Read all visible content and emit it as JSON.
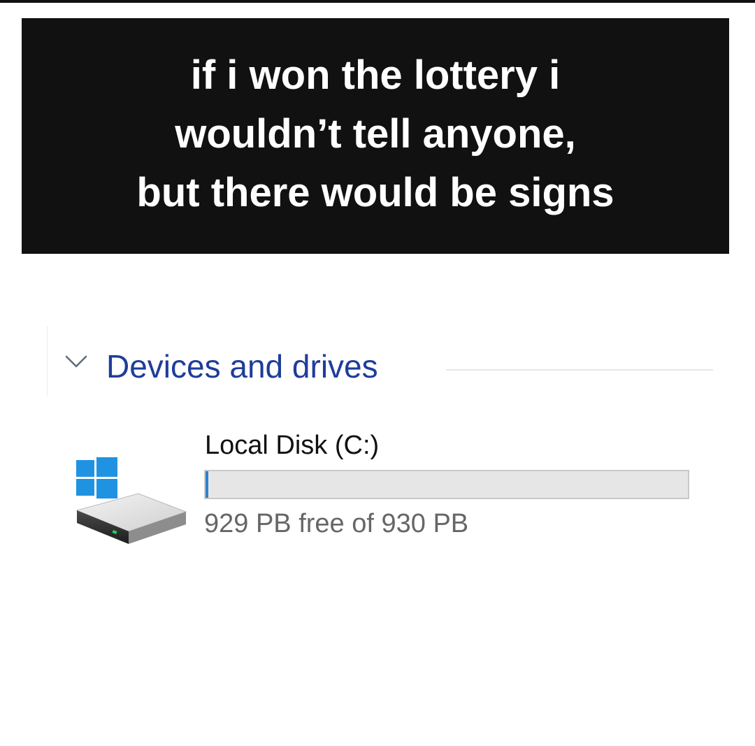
{
  "caption": {
    "text": "if i won the lottery i\nwouldn’t tell anyone,\nbut there would be signs"
  },
  "explorer": {
    "group": {
      "title": "Devices and drives",
      "icon": "chevron-down-icon",
      "title_color": "#1f3d99"
    },
    "drive": {
      "name": "Local Disk (C:)",
      "space_text": "929 PB free of 930 PB",
      "used_fraction": 0.0011,
      "icon": "hard-drive-windows-icon",
      "bar_color": "#2b83d0"
    }
  }
}
